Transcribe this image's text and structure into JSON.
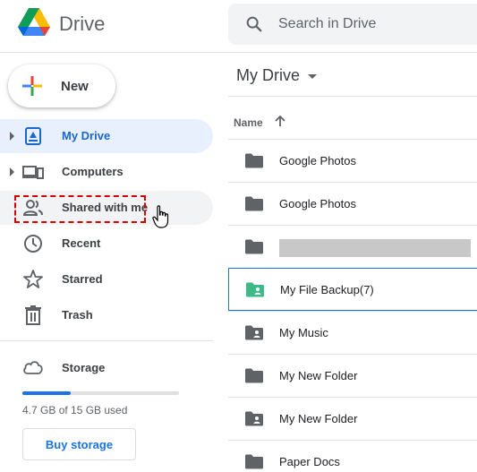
{
  "header": {
    "brand": "Drive",
    "search_placeholder": "Search in Drive"
  },
  "sidebar": {
    "new_label": "New",
    "items": [
      {
        "label": "My Drive",
        "icon": "my-drive-icon"
      },
      {
        "label": "Computers",
        "icon": "computers-icon"
      },
      {
        "label": "Shared with me",
        "icon": "shared-people-icon"
      },
      {
        "label": "Recent",
        "icon": "clock-icon"
      },
      {
        "label": "Starred",
        "icon": "star-icon"
      },
      {
        "label": "Trash",
        "icon": "trash-icon"
      }
    ],
    "storage": {
      "label": "Storage",
      "usage_text": "4.7 GB of 15 GB used",
      "used_fraction": 0.31,
      "buy_label": "Buy storage"
    }
  },
  "main": {
    "title": "My Drive",
    "column_name": "Name",
    "files": [
      {
        "name": "Google Photos",
        "icon": "folder-icon"
      },
      {
        "name": "Google Photos",
        "icon": "folder-icon"
      },
      {
        "name": "",
        "icon": "folder-icon",
        "redacted": true
      },
      {
        "name": "My File Backup(7)",
        "icon": "shared-folder-icon"
      },
      {
        "name": "My Music",
        "icon": "shared-folder-icon"
      },
      {
        "name": "My New Folder",
        "icon": "folder-icon"
      },
      {
        "name": "My New Folder",
        "icon": "shared-folder-icon"
      },
      {
        "name": "Paper Docs",
        "icon": "folder-icon"
      }
    ]
  },
  "colors": {
    "accent": "#1a73e8",
    "active_bg": "#e8f0fe",
    "highlight": "#d50000",
    "folder": "#5f6368",
    "backup_folder": "#3dba87"
  }
}
